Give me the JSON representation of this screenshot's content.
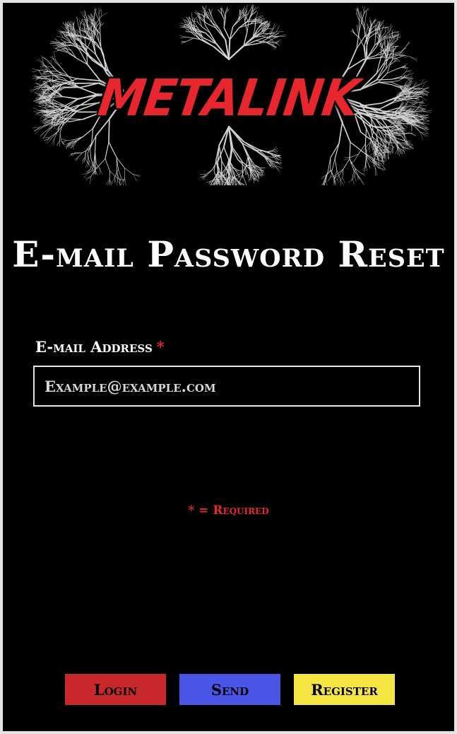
{
  "banner": {
    "logo_text": "METALINK"
  },
  "page": {
    "title": "E-mail Password Reset"
  },
  "form": {
    "email_label": "E-mail Address",
    "required_marker": "*",
    "email_placeholder": "Example@example.com",
    "email_value": ""
  },
  "required_note": "* = Required",
  "buttons": {
    "login_label": "Login",
    "send_label": "Send",
    "register_label": "Register"
  },
  "colors": {
    "background": "#000000",
    "accent_red": "#e8262e",
    "login_button": "#c8282c",
    "send_button": "#4a55e8",
    "register_button": "#f5e542"
  }
}
